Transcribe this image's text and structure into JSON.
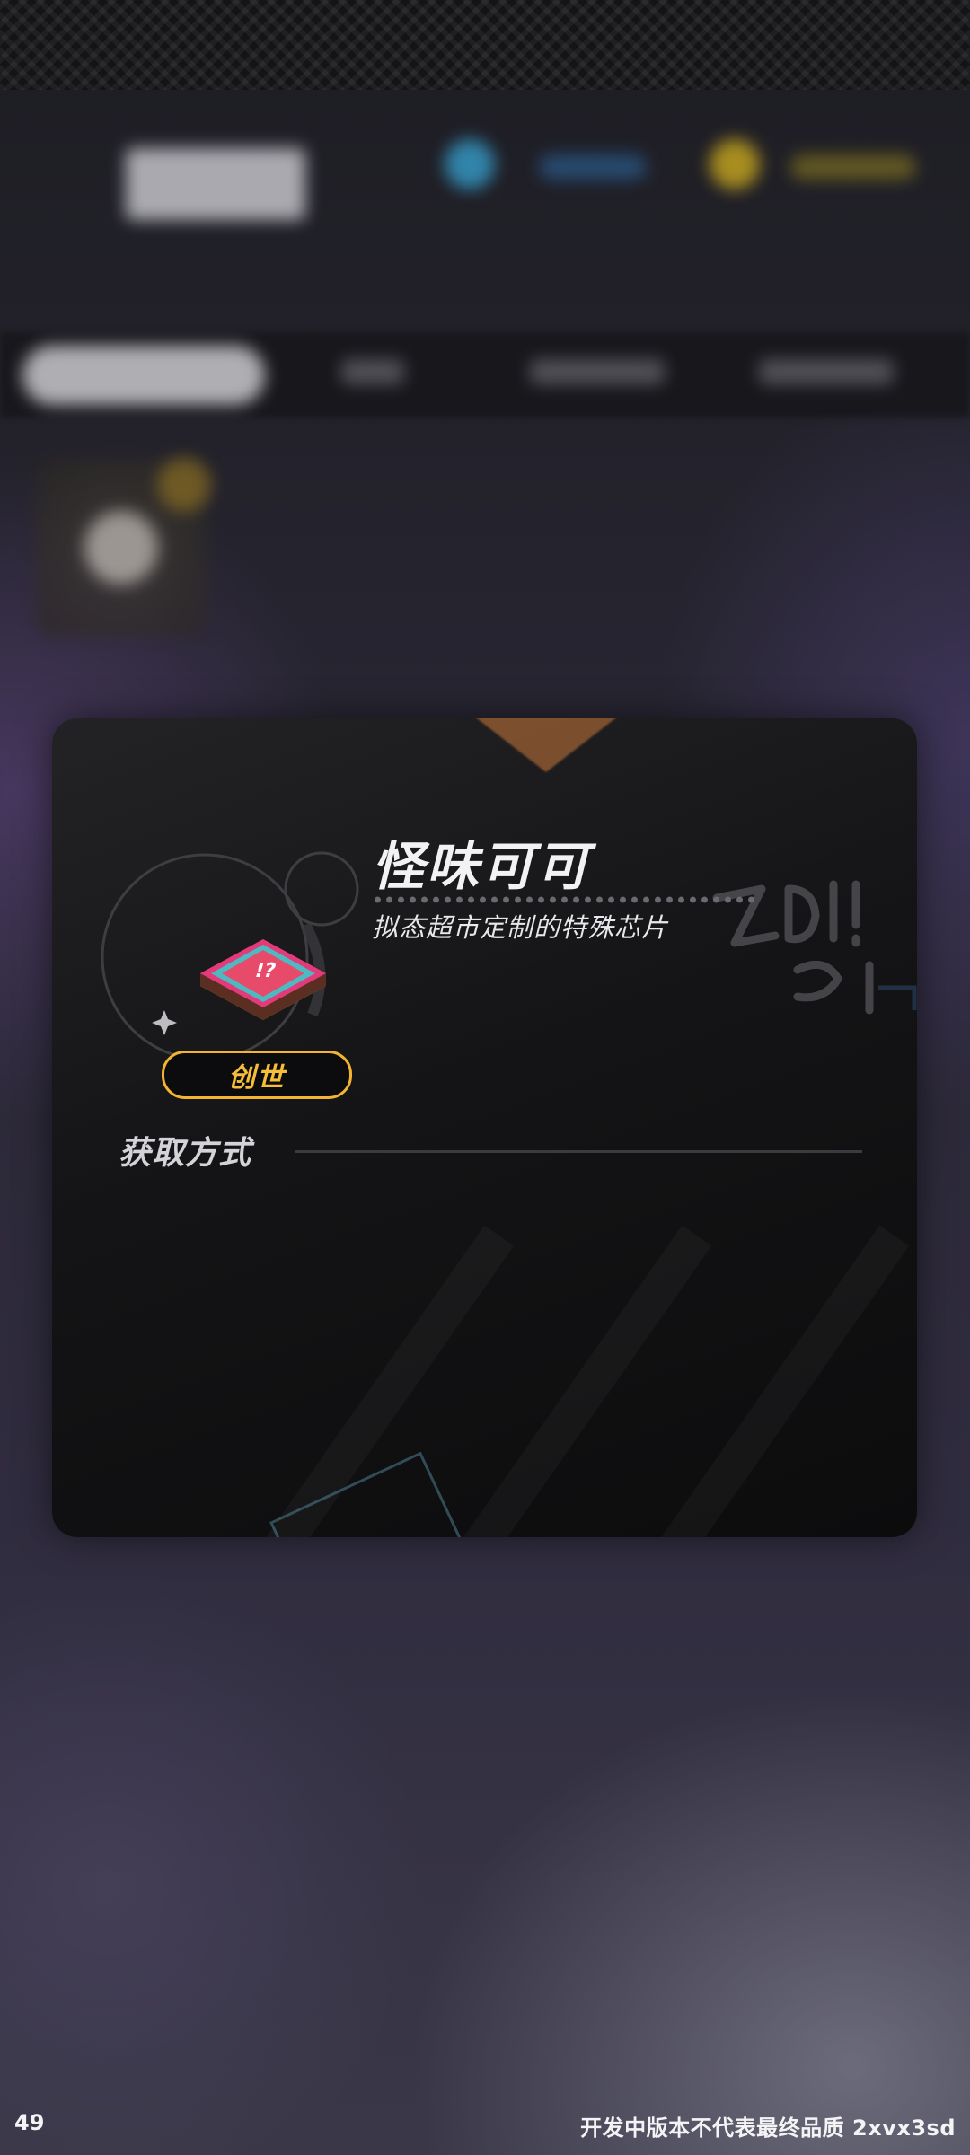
{
  "item": {
    "name": "怪味可可",
    "description": "拟态超市定制的特殊芯片",
    "rarity": "创世",
    "icon": "cocoa-chip-icon"
  },
  "acquire": {
    "heading": "获取方式"
  },
  "footer": {
    "fps": "49",
    "watermark": "开发中版本不代表最终品质 2xvx3sd"
  },
  "colors": {
    "rarity_accent": "#f4b431",
    "card_background": "#141416",
    "text_primary": "#f2f2f4"
  }
}
